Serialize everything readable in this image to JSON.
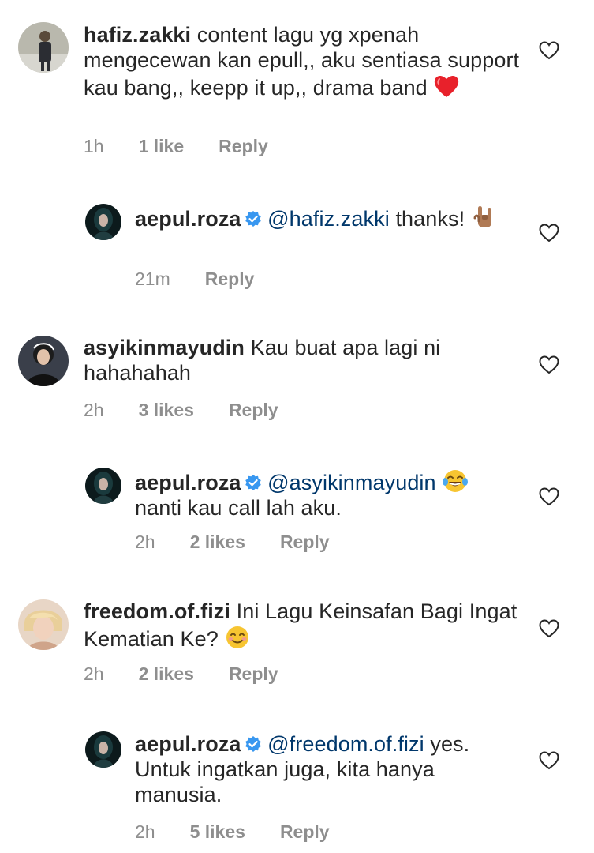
{
  "comments": [
    {
      "username": "hafiz.zakki",
      "text": "content lagu yg xpenah mengecewan kan epull,, aku sentiasa support kau bang,, keepp it up,, drama band",
      "emoji": "red-heart",
      "time": "1h",
      "likes": "1 like",
      "reply_label": "Reply"
    },
    {
      "username": "aepul.roza",
      "verified": true,
      "mention": "@hafiz.zakki",
      "text": "thanks!",
      "emoji": "sign-of-horns",
      "time": "21m",
      "reply_label": "Reply"
    },
    {
      "username": "asyikinmayudin",
      "text": "Kau buat apa lagi ni hahahahah",
      "time": "2h",
      "likes": "3 likes",
      "reply_label": "Reply"
    },
    {
      "username": "aepul.roza",
      "verified": true,
      "mention": "@asyikinmayudin",
      "emoji": "tears-of-joy",
      "text": "nanti kau call lah aku.",
      "time": "2h",
      "likes": "2 likes",
      "reply_label": "Reply"
    },
    {
      "username": "freedom.of.fizi",
      "text": "Ini Lagu Keinsafan Bagi Ingat Kematian Ke?",
      "emoji": "smiling-face",
      "time": "2h",
      "likes": "2 likes",
      "reply_label": "Reply"
    },
    {
      "username": "aepul.roza",
      "verified": true,
      "mention": "@freedom.of.fizi",
      "text": "yes. Untuk ingatkan juga, kita hanya manusia.",
      "time": "2h",
      "likes": "5 likes",
      "reply_label": "Reply"
    }
  ],
  "colors": {
    "text": "#262626",
    "meta": "#8e8e8e",
    "mention": "#00376b",
    "verified": "#3897f0"
  }
}
